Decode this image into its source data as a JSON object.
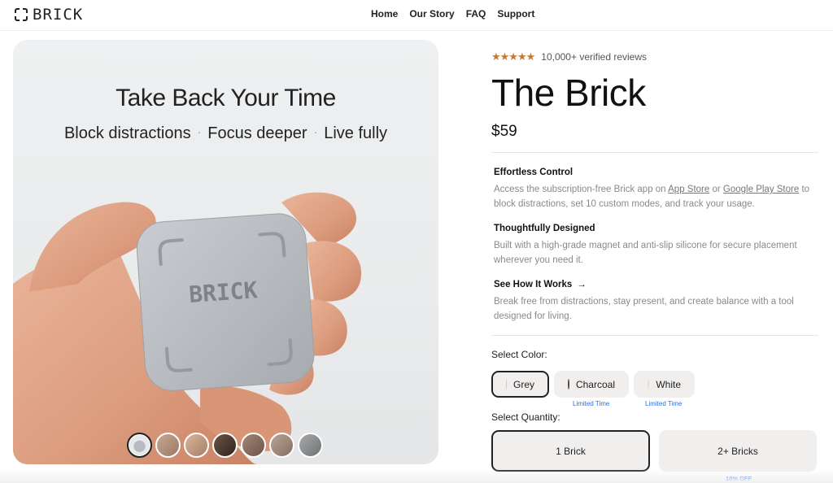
{
  "header": {
    "logo_text": "BRICK",
    "nav": [
      "Home",
      "Our Story",
      "FAQ",
      "Support"
    ]
  },
  "hero": {
    "title": "Take Back Your Time",
    "subtitle_parts": [
      "Block distractions",
      "Focus deeper",
      "Live fully"
    ],
    "separator": "·",
    "device_label": "BRICK",
    "thumbnail_count": 7,
    "active_thumbnail": 1
  },
  "product": {
    "rating_stars": "★★★★★",
    "reviews": "10,000+ verified reviews",
    "title": "The Brick",
    "price": "$59",
    "accent_color": "#c9772e"
  },
  "features": [
    {
      "title": "Effortless Control",
      "text_before": "Access the subscription-free Brick app on ",
      "link1": "App Store",
      "text_mid": " or ",
      "link2": "Google Play Store",
      "text_after": " to block distractions, set 10 custom modes, and track your usage."
    },
    {
      "title": "Thoughtfully Designed",
      "text": "Built with a high-grade magnet and anti-slip silicone for secure placement wherever you need it."
    },
    {
      "title": "See How It Works",
      "arrow": "→",
      "text": "Break free from distractions, stay present, and create balance with a tool designed for living."
    }
  ],
  "color_select": {
    "label": "Select Color:",
    "options": [
      {
        "name": "Grey",
        "swatch": "#c8c8c8",
        "selected": true,
        "badge": ""
      },
      {
        "name": "Charcoal",
        "swatch": "#4a4a4a",
        "selected": false,
        "badge": "Limited Time"
      },
      {
        "name": "White",
        "swatch": "#ffffff",
        "selected": false,
        "badge": "Limited Time"
      }
    ]
  },
  "quantity_select": {
    "label": "Select Quantity:",
    "options": [
      {
        "name": "1 Brick",
        "selected": true
      },
      {
        "name": "2+ Bricks",
        "selected": false
      }
    ],
    "discount_badge": "10% OFF"
  }
}
